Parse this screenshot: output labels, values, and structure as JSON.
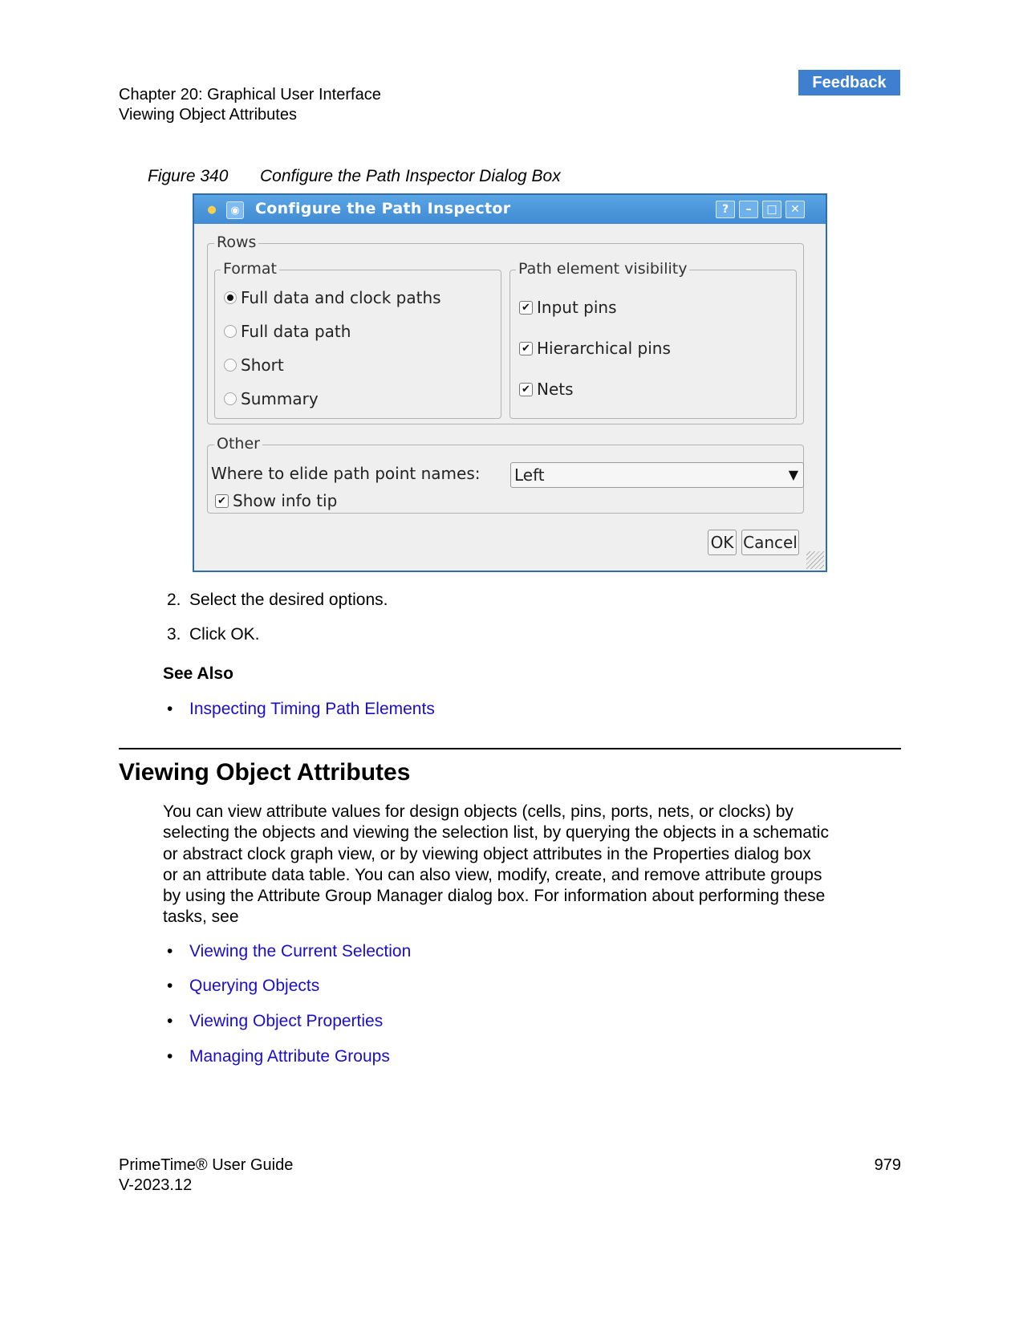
{
  "header": {
    "chapter": "Chapter 20: Graphical User Interface",
    "section": "Viewing Object Attributes",
    "feedback_label": "Feedback"
  },
  "figure": {
    "number": "Figure 340",
    "caption": "Configure the Path Inspector Dialog Box"
  },
  "dialog": {
    "title": "Configure the Path Inspector",
    "titlebar_buttons": [
      "?",
      "–",
      "□",
      "✕"
    ],
    "rows_group": "Rows",
    "format_group": "Format",
    "format_options": [
      {
        "label": "Full data and clock paths",
        "selected": true
      },
      {
        "label": "Full data path",
        "selected": false
      },
      {
        "label": "Short",
        "selected": false
      },
      {
        "label": "Summary",
        "selected": false
      }
    ],
    "visibility_group": "Path element visibility",
    "visibility_options": [
      {
        "label": "Input pins",
        "checked": true
      },
      {
        "label": "Hierarchical pins",
        "checked": true
      },
      {
        "label": "Nets",
        "checked": true
      }
    ],
    "other_group": "Other",
    "elide_label": "Where to elide path point names:",
    "elide_value": "Left",
    "show_info_tip_label": "Show info tip",
    "show_info_tip_checked": true,
    "ok_label": "OK",
    "cancel_label": "Cancel"
  },
  "steps": [
    {
      "num": "2.",
      "text": "Select the desired options."
    },
    {
      "num": "3.",
      "text": "Click OK."
    }
  ],
  "see_also": {
    "heading": "See Also",
    "links": [
      "Inspecting Timing Path Elements"
    ]
  },
  "section": {
    "heading": "Viewing Object Attributes",
    "paragraph_lines": [
      "You can view attribute values for design objects (cells, pins, ports, nets, or clocks) by",
      "selecting the objects and viewing the selection list, by querying the objects in a schematic",
      "or abstract clock graph view, or by viewing object attributes in the Properties dialog box",
      "or an attribute data table. You can also view, modify, create, and remove attribute groups",
      "by using the Attribute Group Manager dialog box. For information about performing these",
      "tasks, see"
    ],
    "links": [
      "Viewing the Current Selection",
      "Querying Objects",
      "Viewing Object Properties",
      "Managing Attribute Groups"
    ]
  },
  "footer": {
    "product": "PrimeTime® User Guide",
    "version": "V-2023.12",
    "page_number": "979"
  }
}
